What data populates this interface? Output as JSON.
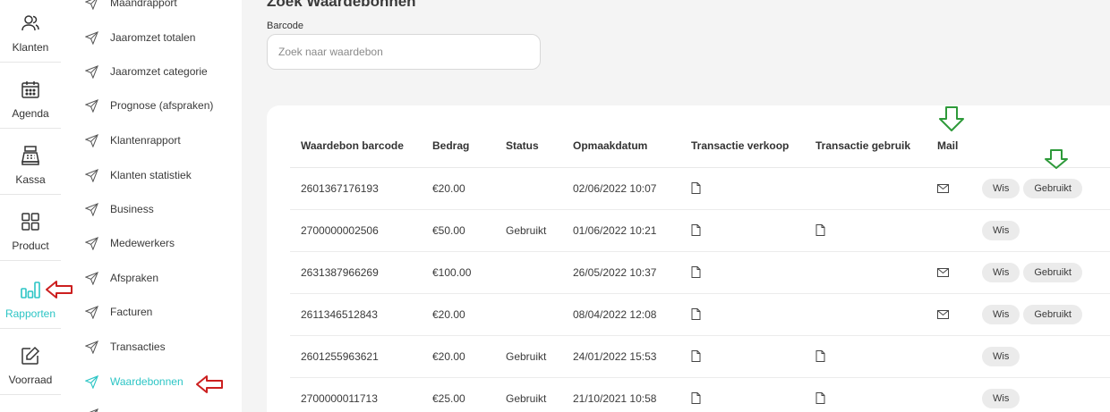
{
  "rail": [
    {
      "label": "Klanten",
      "icon": "users-icon"
    },
    {
      "label": "Agenda",
      "icon": "calendar-icon"
    },
    {
      "label": "Kassa",
      "icon": "cash-register-icon"
    },
    {
      "label": "Product",
      "icon": "grid-icon"
    },
    {
      "label": "Rapporten",
      "icon": "bar-chart-icon",
      "active": true
    },
    {
      "label": "Voorraad",
      "icon": "edit-icon"
    }
  ],
  "menu": [
    {
      "label": "Maandrapport"
    },
    {
      "label": "Jaaromzet totalen"
    },
    {
      "label": "Jaaromzet categorie"
    },
    {
      "label": "Prognose (afspraken)"
    },
    {
      "label": "Klantenrapport"
    },
    {
      "label": "Klanten statistiek"
    },
    {
      "label": "Business"
    },
    {
      "label": "Medewerkers"
    },
    {
      "label": "Afspraken"
    },
    {
      "label": "Facturen"
    },
    {
      "label": "Transacties"
    },
    {
      "label": "Waardebonnen",
      "active": true
    }
  ],
  "page": {
    "title": "Zoek Waardebonnen",
    "barcode_label": "Barcode",
    "search_placeholder": "Zoek naar waardebon"
  },
  "table": {
    "headers": [
      "Waardebon barcode",
      "Bedrag",
      "Status",
      "Opmaakdatum",
      "Transactie verkoop",
      "Transactie gebruik",
      "Mail",
      ""
    ],
    "rows": [
      {
        "barcode": "2601367176193",
        "bedrag": "€20.00",
        "status": "",
        "datum": "02/06/2022 10:07",
        "verkoop_doc": true,
        "gebruik_doc": false,
        "mail": true,
        "actions": [
          "Wis",
          "Gebruikt"
        ]
      },
      {
        "barcode": "2700000002506",
        "bedrag": "€50.00",
        "status": "Gebruikt",
        "datum": "01/06/2022 10:21",
        "verkoop_doc": true,
        "gebruik_doc": true,
        "mail": false,
        "actions": [
          "Wis"
        ]
      },
      {
        "barcode": "2631387966269",
        "bedrag": "€100.00",
        "status": "",
        "datum": "26/05/2022 10:37",
        "verkoop_doc": true,
        "gebruik_doc": false,
        "mail": true,
        "actions": [
          "Wis",
          "Gebruikt"
        ]
      },
      {
        "barcode": "2611346512843",
        "bedrag": "€20.00",
        "status": "",
        "datum": "08/04/2022 12:08",
        "verkoop_doc": true,
        "gebruik_doc": false,
        "mail": true,
        "actions": [
          "Wis",
          "Gebruikt"
        ]
      },
      {
        "barcode": "2601255963621",
        "bedrag": "€20.00",
        "status": "Gebruikt",
        "datum": "24/01/2022 15:53",
        "verkoop_doc": true,
        "gebruik_doc": true,
        "mail": false,
        "actions": [
          "Wis"
        ]
      },
      {
        "barcode": "2700000011713",
        "bedrag": "€25.00",
        "status": "Gebruikt",
        "datum": "21/10/2021 10:58",
        "verkoop_doc": true,
        "gebruik_doc": true,
        "mail": false,
        "actions": [
          "Wis"
        ]
      }
    ]
  },
  "colors": {
    "accent": "#2cc5c5",
    "annotation_red": "#cc1f1f",
    "annotation_green": "#2e9a3a"
  }
}
